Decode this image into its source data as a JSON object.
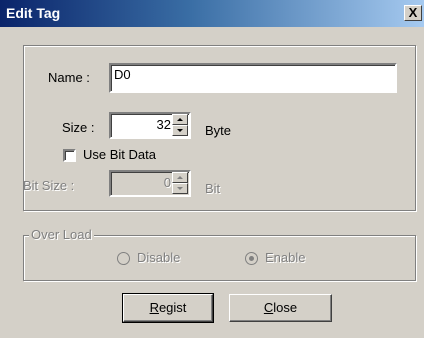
{
  "dialog": {
    "title": "Edit Tag",
    "close_glyph": "X"
  },
  "fields": {
    "name_label": "Name :",
    "name_value": "D0",
    "size_label": "Size :",
    "size_value": "32",
    "size_unit": "Byte",
    "use_bit_label": "Use Bit Data",
    "use_bit_checked": false,
    "bit_size_label": "Bit Size :",
    "bit_size_value": "0",
    "bit_unit": "Bit"
  },
  "over_load": {
    "legend": "Over Load",
    "options": [
      {
        "label": "Disable",
        "checked": false
      },
      {
        "label": "Enable",
        "checked": true
      }
    ]
  },
  "buttons": {
    "regist_mnemonic": "R",
    "regist_rest": "egist",
    "close_mnemonic": "C",
    "close_rest": "lose"
  },
  "icons": {
    "close": "close-icon",
    "spin_up": "chevron-up-icon",
    "spin_down": "chevron-down-icon"
  }
}
